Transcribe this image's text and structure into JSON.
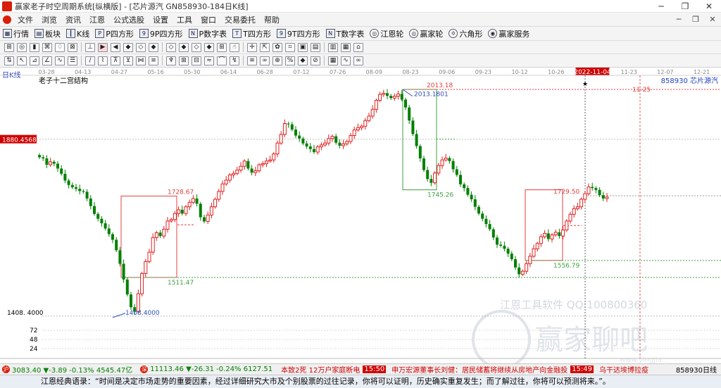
{
  "window": {
    "title": "赢家老子时空周期系统[纵横版] - [芯片源汽  GN858930-184日K线]",
    "min": "─",
    "max": "❐",
    "close": "✕"
  },
  "menu": {
    "items": [
      "文件",
      "浏览",
      "资讯",
      "江恩",
      "公式选股",
      "设置",
      "工具",
      "窗口",
      "交易委托",
      "帮助"
    ],
    "right": [
      "─",
      "❐",
      "✕"
    ]
  },
  "toolbar": {
    "buttons": [
      {
        "icon": "grid-icon",
        "glyph": "▦",
        "label": "行情"
      },
      {
        "icon": "blocks-icon",
        "glyph": "▤",
        "label": "板块"
      },
      {
        "icon": "kline-icon",
        "glyph": "┃",
        "label": "K线"
      },
      {
        "icon": "p-square-icon",
        "glyph": "P",
        "label": "P四方形"
      },
      {
        "icon": "9p-square-icon",
        "glyph": "9",
        "label": "9P四方形"
      },
      {
        "icon": "pn-square-icon",
        "glyph": "N",
        "label": "P数字表"
      },
      {
        "icon": "t-square-icon",
        "glyph": "T",
        "label": "T四方形"
      },
      {
        "icon": "9t-square-icon",
        "glyph": "9",
        "label": "9T四方形"
      },
      {
        "icon": "tn-square-icon",
        "glyph": "N",
        "label": "T数字表"
      },
      {
        "icon": "gann-wheel-icon",
        "glyph": "◎",
        "label": "江恩轮"
      },
      {
        "icon": "winner-wheel-icon",
        "glyph": "◎",
        "label": "赢家轮"
      },
      {
        "icon": "hexagon-icon",
        "glyph": "✡",
        "label": "六角形"
      },
      {
        "icon": "service-icon",
        "glyph": "◉",
        "label": "赢家服务"
      }
    ]
  },
  "tools_row1": [
    "⊞",
    "◎",
    "▮",
    "⌘",
    "♢",
    "⊠",
    "⊥",
    "▶",
    "◀",
    "◆",
    "◇",
    "◆",
    "◇",
    "◆",
    "◇",
    "◆",
    "⊞",
    "☝",
    "✛",
    "⇱",
    "✿",
    "⌗",
    "▣",
    "▤",
    "▥",
    "▦",
    "⌂"
  ],
  "tools_row2": [
    "⇅",
    "↖",
    "⊿",
    "∠",
    "∿",
    "☰",
    "/",
    "⌇",
    "⊼",
    "⊻",
    "⋈",
    "≡",
    "♆",
    "⊞",
    "⊟",
    "≈",
    "⌒",
    "↯",
    "≋",
    "∞",
    "⊕",
    "%",
    "◆",
    "⊘",
    "▦",
    "∿",
    "∞"
  ],
  "chart_data": {
    "type": "candlestick",
    "period_label": "日K线",
    "indicator_label": "老子十二宫结构",
    "stock_label": "858930 芯片源汽",
    "x_dates": [
      "03-28",
      "04-13",
      "04-27",
      "05-16",
      "05-30",
      "06-14",
      "06-28",
      "07-12",
      "07-26",
      "08-09",
      "08-23",
      "09-06",
      "09-23",
      "10-12",
      "10-26",
      "2022-11-04",
      "11-23",
      "12-07",
      "12-21"
    ],
    "current_price_label": "1880.4568",
    "left_axis_low_label": "1408. 4000",
    "volume_ticks": [
      "72",
      "48",
      "24"
    ],
    "annotations": {
      "high": "2013.18",
      "high_marker": "2013.1801",
      "low": "1408.4000",
      "box1_top": "1728.67",
      "box1_bottom": "1511.47",
      "box2_top": "1745.26",
      "box3_top": "1729.50",
      "box3_bottom": "1556.79",
      "future_date": "11-25"
    },
    "approximate_closes": [
      1832,
      1829,
      1812,
      1820,
      1815,
      1802,
      1788,
      1770,
      1758,
      1752,
      1748,
      1742,
      1740,
      1722,
      1702,
      1681,
      1668,
      1656,
      1642,
      1627,
      1612,
      1584,
      1548,
      1506,
      1466,
      1432,
      1420,
      1468,
      1522,
      1554,
      1579,
      1618,
      1631,
      1622,
      1640,
      1662,
      1666,
      1682,
      1692,
      1682,
      1700,
      1712,
      1722,
      1708,
      1672,
      1661,
      1678,
      1700,
      1720,
      1741,
      1761,
      1771,
      1785,
      1789,
      1798,
      1808,
      1822,
      1802,
      1791,
      1796,
      1812,
      1815,
      1822,
      1825,
      1841,
      1870,
      1893,
      1922,
      1920,
      1906,
      1890,
      1882,
      1869,
      1861,
      1854,
      1846,
      1860,
      1865,
      1870,
      1882,
      1888,
      1871,
      1863,
      1868,
      1874,
      1890,
      1905,
      1911,
      1915,
      1930,
      1942,
      1960,
      1984,
      2000,
      2003,
      1996,
      1990,
      1995,
      2001,
      1986,
      1965,
      1930,
      1894,
      1862,
      1829,
      1798,
      1774,
      1764,
      1790,
      1810,
      1825,
      1830,
      1822,
      1800,
      1785,
      1760,
      1750,
      1732,
      1720,
      1700,
      1682,
      1668,
      1654,
      1640,
      1618,
      1599,
      1596,
      1588,
      1575,
      1560,
      1538,
      1520,
      1528,
      1548,
      1568,
      1588,
      1602,
      1620,
      1629,
      1614,
      1625,
      1632,
      1622,
      1638,
      1662,
      1680,
      1695,
      1700,
      1720,
      1735,
      1753,
      1750,
      1745,
      1731,
      1722,
      1726
    ]
  },
  "status": {
    "index1_badge": "沪",
    "index1": "3083.40 ▼-3.89 -0.13% 4545.47亿",
    "index2_badge": "深",
    "index2": "11113.46 ▼-26.31 -0.24% 6127.51",
    "news1": "本致2死 12万户家庭断电",
    "news2_time": "15:50",
    "news2": "申万宏源董事长刘健：居民储蓄将继续从房地产向金融投",
    "news3_time": "15:49",
    "news3": "乌干达埃博拉疫",
    "stock": "858930日线"
  },
  "quote": "江恩经典语录：“时间是决定市场走势的重要因素，经过详细研究大市及个别股票的过往记录，你将可以证明，历史确实重复发生；而了解过往，你将可以预测将来。”。",
  "watermark": {
    "line1": "江恩工具软件  QQ:100800360",
    "brand": "赢家聊吧",
    "brand_small": "www.yingjia..."
  }
}
